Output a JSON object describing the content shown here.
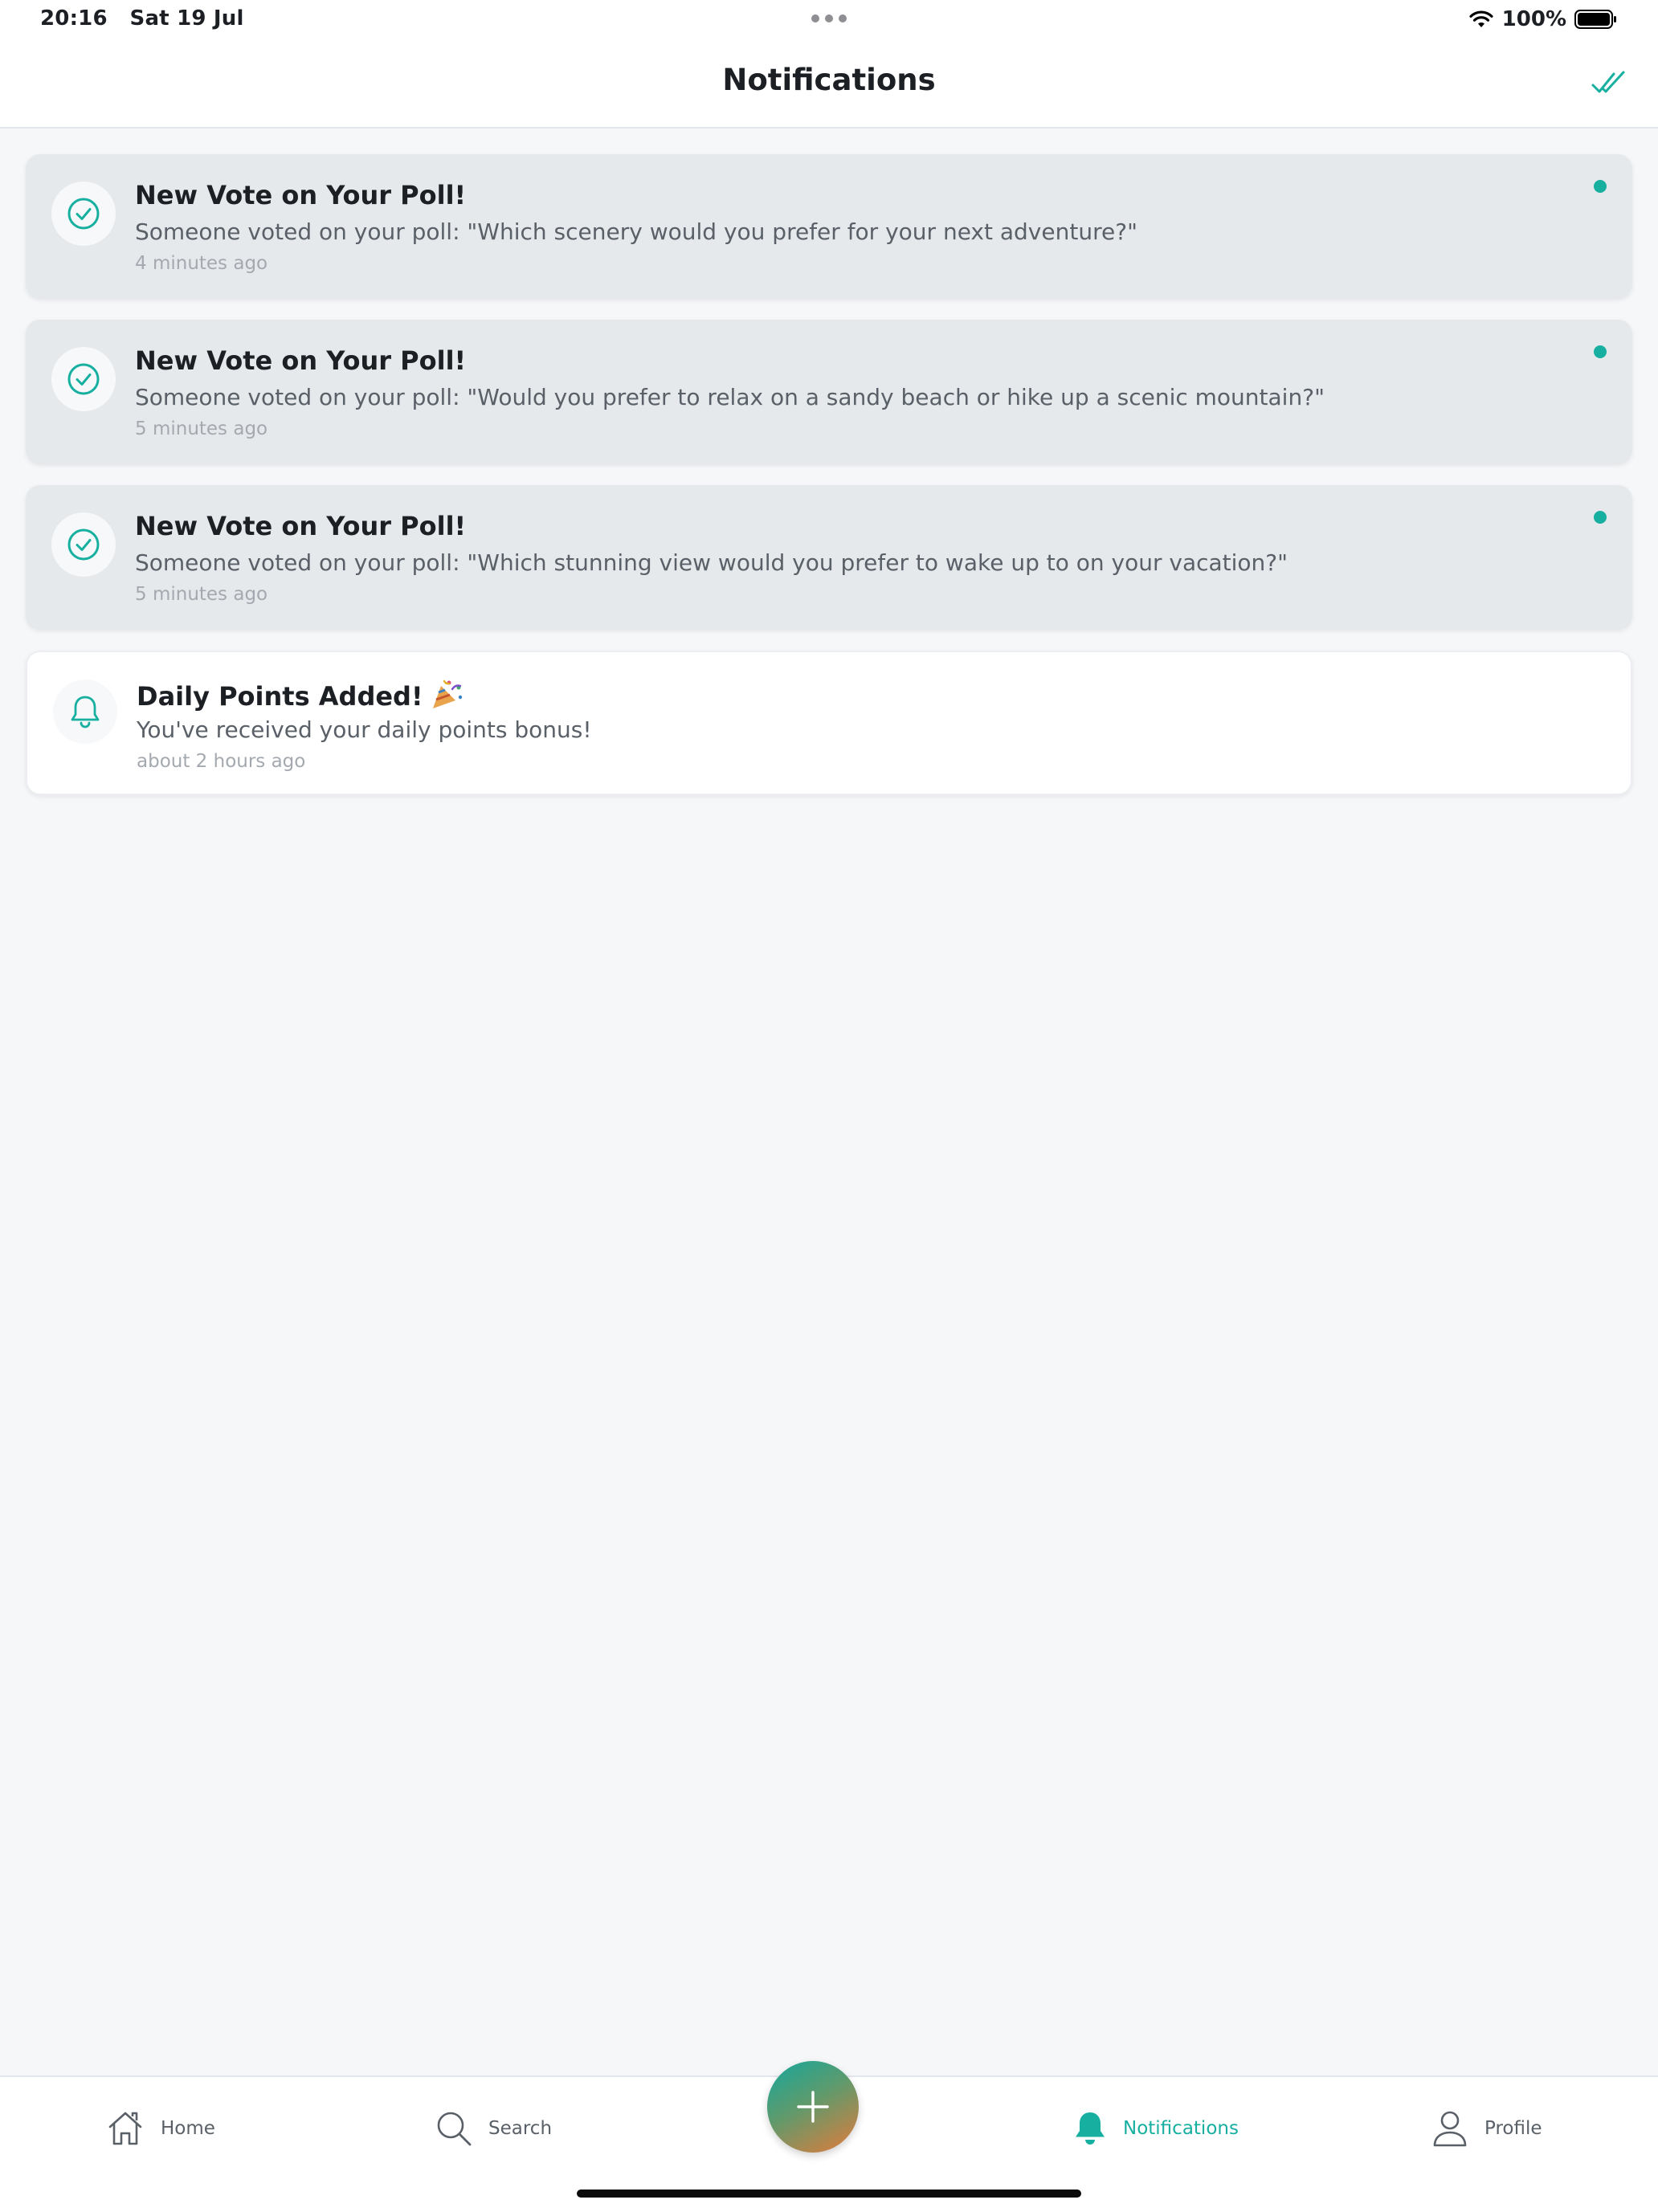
{
  "status_bar": {
    "time_date": "20:16   Sat 19 Jul",
    "battery": "100%"
  },
  "header": {
    "title": "Notifications",
    "mark_all_read_icon": "double-check-icon"
  },
  "colors": {
    "accent": "#17b0a0",
    "unread_card": "#e6e9ec",
    "read_card": "#ffffff",
    "background": "#f6f7f9"
  },
  "notifications": [
    {
      "title": "New Vote on Your Poll!",
      "body": "Someone voted on your poll: \"Which scenery would you prefer for your next adventure?\"",
      "time": "4 minutes ago",
      "icon": "check-circle-icon",
      "unread": true
    },
    {
      "title": "New Vote on Your Poll!",
      "body": "Someone voted on your poll: \"Would you prefer to relax on a sandy beach or hike up a scenic mountain?\"",
      "time": "5 minutes ago",
      "icon": "check-circle-icon",
      "unread": true
    },
    {
      "title": "New Vote on Your Poll!",
      "body": "Someone voted on your poll: \"Which stunning view would you prefer to wake up to on your vacation?\"",
      "time": "5 minutes ago",
      "icon": "check-circle-icon",
      "unread": true
    },
    {
      "title": "Daily Points Added!",
      "body": "You've received your daily points bonus!",
      "time": "about 2 hours ago",
      "icon": "bell-icon",
      "emoji_icon": "party-popper-icon",
      "unread": false
    }
  ],
  "tab_bar": {
    "home": "Home",
    "search": "Search",
    "create_icon": "plus-icon",
    "notifications": "Notifications",
    "profile": "Profile",
    "active": "notifications"
  }
}
